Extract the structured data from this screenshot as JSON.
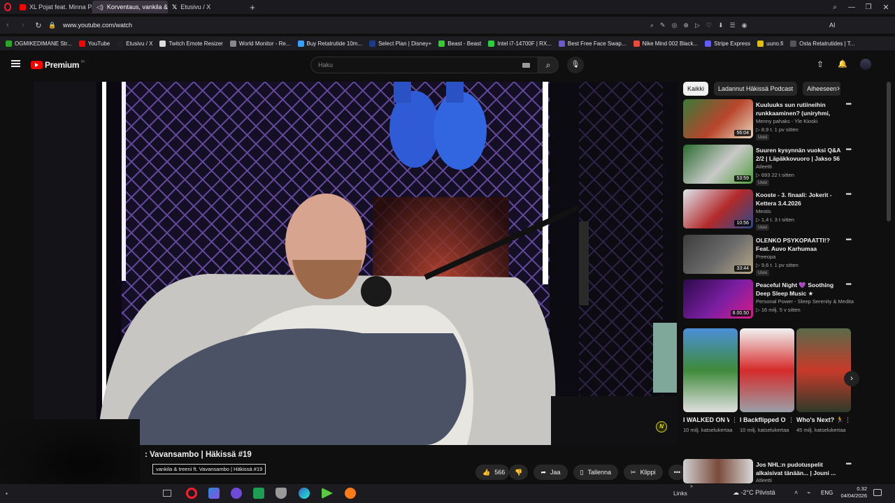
{
  "browser": {
    "tabs": [
      {
        "label": "XL Pojat feat. Minna Pajul"
      },
      {
        "label": "Korventaus, vankila &"
      },
      {
        "label": "Etusivu / X"
      }
    ],
    "url": "www.youtube.com/watch",
    "ext_label": "AI"
  },
  "bookmarks": [
    {
      "label": "OGMIKEDIMANE Str...",
      "color": "#2aa52a"
    },
    {
      "label": "YouTube",
      "color": "#ff0000"
    },
    {
      "label": "Etusivu / X",
      "color": "#222222"
    },
    {
      "label": "Twitch Emote Resizer",
      "color": "#dddddd"
    },
    {
      "label": "World Monitor - Re...",
      "color": "#888888"
    },
    {
      "label": "Buy Retatrutide 10m...",
      "color": "#3aa0ff"
    },
    {
      "label": "Select Plan | Disney+",
      "color": "#1b3b8a"
    },
    {
      "label": "Beast - Beast",
      "color": "#33cc33"
    },
    {
      "label": "Intel i7-14700F | RX...",
      "color": "#2ecc40"
    },
    {
      "label": "Best Free Face Swap...",
      "color": "#6a5acd"
    },
    {
      "label": "Nike Mind 002 Black...",
      "color": "#e74c3c"
    },
    {
      "label": "Stripe Express",
      "color": "#635bff"
    },
    {
      "label": "uuno.fi",
      "color": "#e0c000"
    },
    {
      "label": "Osta Retatrutides | T...",
      "color": "#555555"
    }
  ],
  "youtube": {
    "logo": "Premium",
    "logo_region": "FI",
    "search_placeholder": "Haku"
  },
  "video": {
    "title_visible": ": Vavansambo | Häkissä #19",
    "tooltip": "vankila & treeni ft. Vavansambo | Häkissä #19",
    "likes": "566",
    "share": "Jaa",
    "save": "Tallenna",
    "clip": "Klippi",
    "overlay_badge": "N"
  },
  "chips": [
    {
      "label": "Kaikki",
      "selected": true
    },
    {
      "label": "Ladannut Häkissä Podcast",
      "selected": false
    },
    {
      "label": "Aiheeseen",
      "selected": false
    }
  ],
  "recommendations": [
    {
      "title": "Kuuluuks sun rutiineihin runkkaaminen? (uniryhmi, rutii...",
      "channel": "Menny pahaks - Yle Kioski",
      "meta": "8,9 t.  1 pv sitten",
      "badge": "Uusi",
      "duration": "56:04",
      "colors": [
        "#3a7a3a",
        "#b8452c",
        "#e8d9c0"
      ]
    },
    {
      "label_note": "",
      "title": "Suuren kysynnän vuoksi Q&A 2/2 | Läpäkkovuoro | Jakso 56",
      "channel": "Atleetti",
      "meta": "693  22 t sitten",
      "badge": "Uusi",
      "duration": "53:59",
      "colors": [
        "#2a6c2f",
        "#c9c9c9",
        "#4f9d3a"
      ]
    },
    {
      "title": "Kooste - 3. finaali: Jokerit - Kettera 3.4.2026",
      "channel": "Mestis",
      "meta": "1,4 t.  3 t sitten",
      "badge": "Uusi",
      "duration": "10:56",
      "colors": [
        "#dfe6ee",
        "#b22a2a",
        "#2b4a8c"
      ]
    },
    {
      "title": "OLENKO PSYKOPAATTI!? Feat. Auvo Karhumaa",
      "channel": "Preeopa",
      "meta": "9,6 t.  1 pv sitten",
      "badge": "Uusi",
      "duration": "33:44",
      "colors": [
        "#3c3c3c",
        "#6b6b6b",
        "#b9a98a"
      ]
    },
    {
      "title": "Peaceful Night 💜 Soothing Deep Sleep Music ★ Calming...",
      "channel": "Personal Power - Sleep Serenity & Medita",
      "meta": "16 milj.  5 v sitten",
      "badge": "",
      "duration": "8.00.50",
      "colors": [
        "#2b0a4a",
        "#7b1fa2",
        "#d81b8a"
      ]
    }
  ],
  "shorts": [
    {
      "title": "I WALKED ON WATER 😨...",
      "views": "10 milj. katselukertaa",
      "colors": [
        "#4a8fd8",
        "#3f8a3a",
        "#e0e0e0"
      ]
    },
    {
      "title": "I Backflipped Off A Flying...",
      "views": "10 milj. katselukertaa",
      "colors": [
        "#f2f2f2",
        "#d62b2b",
        "#9aa0a8"
      ]
    },
    {
      "title": "Who's Next? 🏃💨...",
      "views": "45 milj. katselukertaa",
      "colors": [
        "#5a6b4a",
        "#c83a2a",
        "#2f3a2a"
      ]
    }
  ],
  "next_item": {
    "title": "Jos NHL:n pudotuspelit alkaisivat tänään... | Jouni ...",
    "channel": "Atleetti"
  },
  "taskbar": {
    "links": "Links",
    "weather": "-2°C  Pilvistä",
    "lang": "ENG",
    "time": "0.32",
    "date": "04/04/2026"
  },
  "theme": {
    "accent": "#ff0000",
    "bg": "#0f0f0f"
  }
}
